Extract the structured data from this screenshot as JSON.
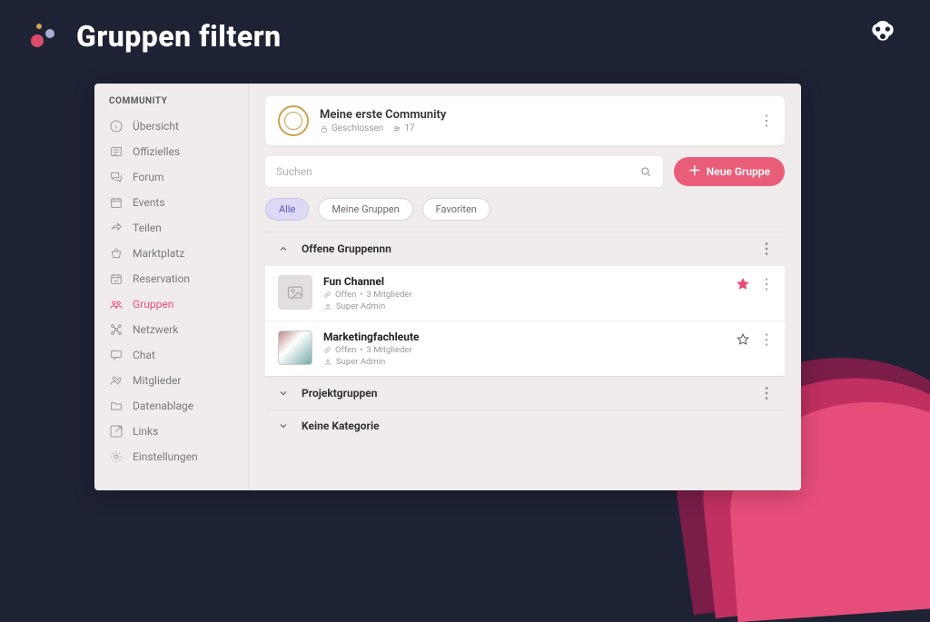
{
  "headline": "Gruppen filtern",
  "sidebar": {
    "title": "COMMUNITY",
    "items": [
      {
        "label": "Übersicht",
        "icon": "info"
      },
      {
        "label": "Offizielles",
        "icon": "news"
      },
      {
        "label": "Forum",
        "icon": "forum"
      },
      {
        "label": "Events",
        "icon": "calendar"
      },
      {
        "label": "Teilen",
        "icon": "share"
      },
      {
        "label": "Marktplatz",
        "icon": "basket"
      },
      {
        "label": "Reservation",
        "icon": "calendar-check"
      },
      {
        "label": "Gruppen",
        "icon": "groups",
        "active": true
      },
      {
        "label": "Netzwerk",
        "icon": "network"
      },
      {
        "label": "Chat",
        "icon": "chat"
      },
      {
        "label": "Mitglieder",
        "icon": "members"
      },
      {
        "label": "Datenablage",
        "icon": "folder"
      },
      {
        "label": "Links",
        "icon": "link"
      },
      {
        "label": "Einstellungen",
        "icon": "gear"
      }
    ]
  },
  "community": {
    "title": "Meine erste Community",
    "status": "Geschlossen",
    "member_count": "17"
  },
  "search": {
    "placeholder": "Suchen"
  },
  "new_group_label": "Neue Gruppe",
  "filters": [
    {
      "label": "Alle",
      "active": true
    },
    {
      "label": "Meine Gruppen"
    },
    {
      "label": "Favoriten"
    }
  ],
  "sections": [
    {
      "title": "Offene Gruppennn",
      "open": true,
      "has_menu": true
    },
    {
      "title": "Projektgruppen",
      "open": false,
      "has_menu": true
    },
    {
      "title": "Keine Kategorie",
      "open": false,
      "has_menu": false
    }
  ],
  "groups": [
    {
      "title": "Fun Channel",
      "status": "Offen",
      "members": "3 Mitglieder",
      "owner": "Super Admin",
      "favorite": true,
      "thumb": "placeholder"
    },
    {
      "title": "Marketingfachleute",
      "status": "Offen",
      "members": "3 Mitglieder",
      "owner": "Super Admin",
      "favorite": false,
      "thumb": "photo"
    }
  ]
}
